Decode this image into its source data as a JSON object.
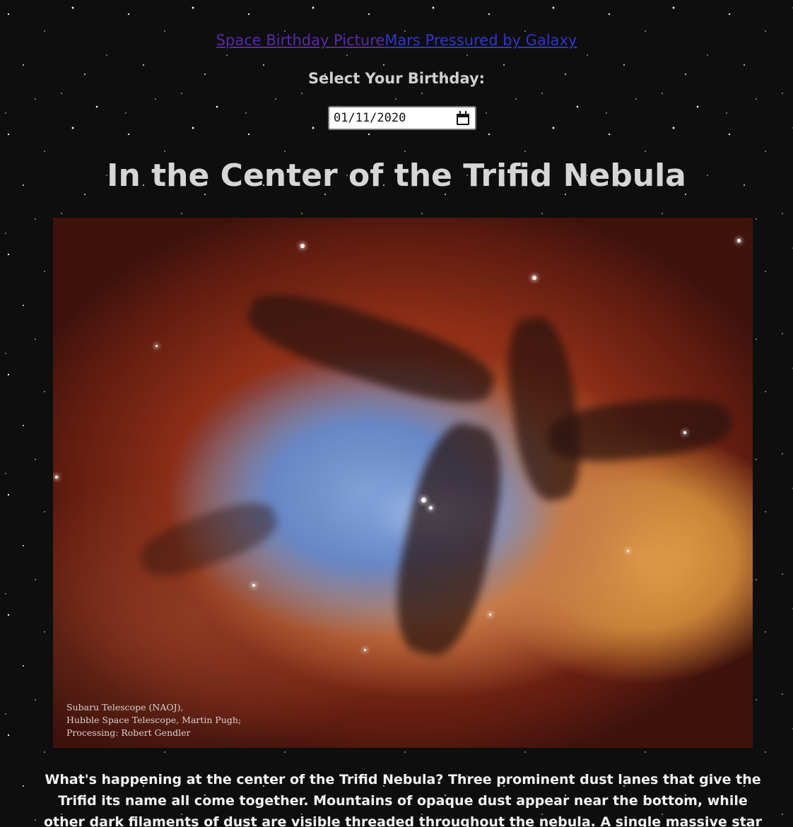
{
  "nav": {
    "links": [
      {
        "label": "Space Birthday Picture",
        "state": "visited",
        "color": "#5a2aa5"
      },
      {
        "label": "Mars Pressured by Galaxy",
        "state": "unvisited",
        "color": "#3434c8"
      }
    ]
  },
  "birthday_picker": {
    "label": "Select Your Birthday:",
    "value": "01/11/2020",
    "icon": "calendar-icon"
  },
  "apod": {
    "title": "In the Center of the Trifid Nebula",
    "image_credit": [
      "Subaru Telescope (NAOJ),",
      "Hubble Space Telescope, Martin Pugh;",
      "Processing: Robert Gendler"
    ],
    "explanation": "What's happening at the center of the Trifid Nebula? Three prominent dust lanes that give the Trifid its name all come together. Mountains of opaque dust appear near the bottom, while other dark filaments of dust are visible threaded throughout the nebula. A single massive star visible"
  },
  "colors": {
    "background": "#0e0e0e",
    "title": "#d6d6d6",
    "explanation_text": "#f2f2f2"
  }
}
